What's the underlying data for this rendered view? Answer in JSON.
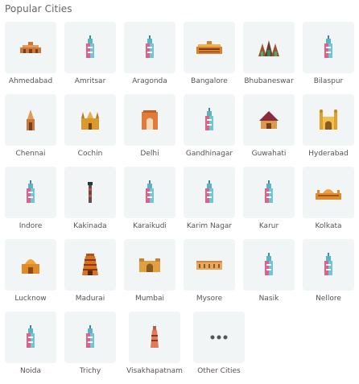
{
  "section_title": "Popular Cities",
  "cities": [
    {
      "label": "Ahmedabad",
      "icon": "monument-low-icon"
    },
    {
      "label": "Amritsar",
      "icon": "tower-icon"
    },
    {
      "label": "Aragonda",
      "icon": "tower-icon"
    },
    {
      "label": "Bangalore",
      "icon": "palace-icon"
    },
    {
      "label": "Bhubaneswar",
      "icon": "temple-spires-icon"
    },
    {
      "label": "Bilaspur",
      "icon": "tower-icon"
    },
    {
      "label": "Chennai",
      "icon": "temple-tower-icon"
    },
    {
      "label": "Cochin",
      "icon": "church-icon"
    },
    {
      "label": "Delhi",
      "icon": "gate-icon"
    },
    {
      "label": "Gandhinagar",
      "icon": "tower-icon"
    },
    {
      "label": "Guwahati",
      "icon": "temple-roof-icon"
    },
    {
      "label": "Hyderabad",
      "icon": "charminar-icon"
    },
    {
      "label": "Indore",
      "icon": "tower-icon"
    },
    {
      "label": "Kakinada",
      "icon": "lighthouse-icon"
    },
    {
      "label": "Karaikudi",
      "icon": "tower-icon"
    },
    {
      "label": "Karim Nagar",
      "icon": "tower-icon"
    },
    {
      "label": "Karur",
      "icon": "tower-icon"
    },
    {
      "label": "Kolkata",
      "icon": "memorial-icon"
    },
    {
      "label": "Lucknow",
      "icon": "mausoleum-icon"
    },
    {
      "label": "Madurai",
      "icon": "gopuram-icon"
    },
    {
      "label": "Mumbai",
      "icon": "gateway-icon"
    },
    {
      "label": "Mysore",
      "icon": "palace-wide-icon"
    },
    {
      "label": "Nasik",
      "icon": "tower-icon"
    },
    {
      "label": "Nellore",
      "icon": "tower-icon"
    },
    {
      "label": "Noida",
      "icon": "tower-icon"
    },
    {
      "label": "Trichy",
      "icon": "tower-icon"
    },
    {
      "label": "Visakhapatnam",
      "icon": "temple-tall-icon"
    },
    {
      "label": "Other Cities",
      "icon": "more-dots-icon"
    }
  ]
}
